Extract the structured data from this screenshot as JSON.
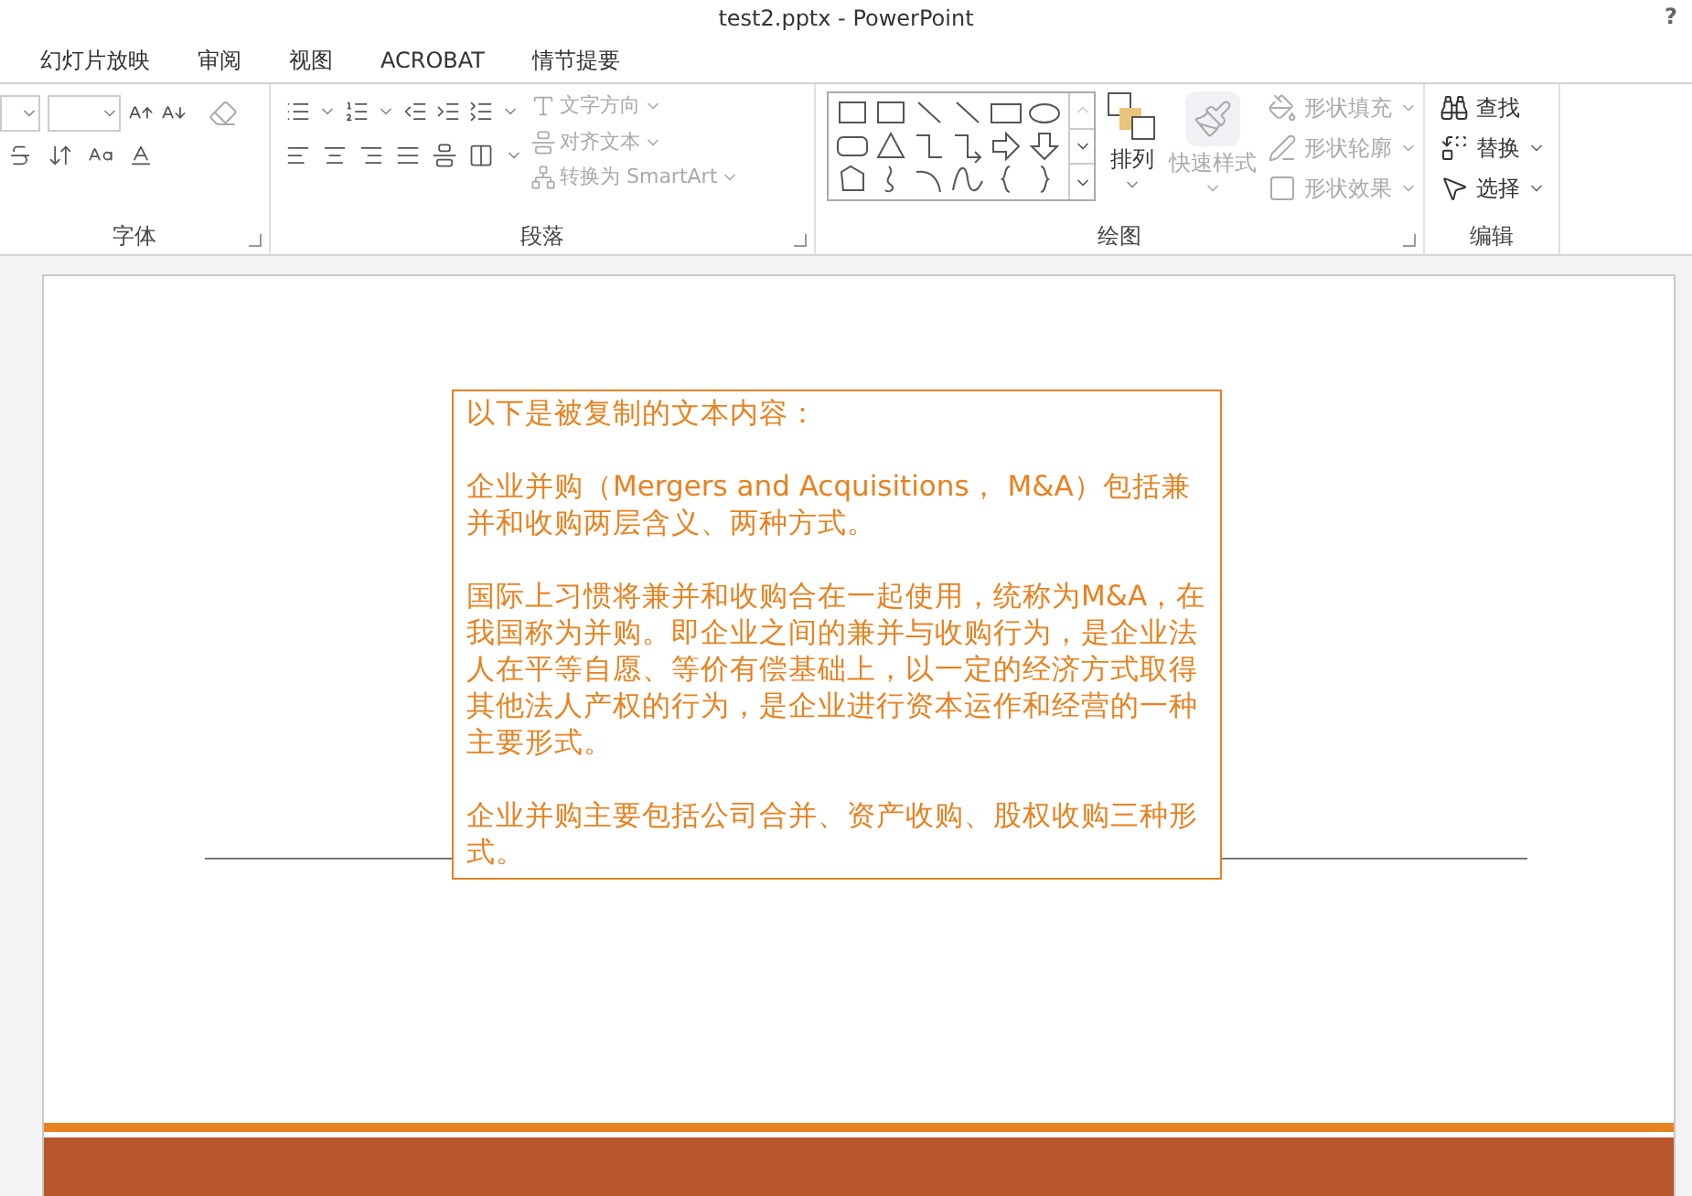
{
  "window": {
    "title": "test2.pptx - PowerPoint",
    "help": "?"
  },
  "tabs": [
    {
      "label": "幻灯片放映",
      "selected": false
    },
    {
      "label": "审阅",
      "selected": false
    },
    {
      "label": "视图",
      "selected": false
    },
    {
      "label": "ACROBAT",
      "selected": false
    },
    {
      "label": "情节提要",
      "selected": false
    }
  ],
  "ribbon": {
    "font_group": {
      "label": "字体"
    },
    "paragraph_group": {
      "label": "段落",
      "commands": [
        {
          "label": "文字方向",
          "disabled": true
        },
        {
          "label": "对齐文本",
          "disabled": true
        },
        {
          "label": "转换为 SmartArt",
          "disabled": true
        }
      ]
    },
    "drawing_group": {
      "label": "绘图",
      "arrange": "排列",
      "quick_styles": {
        "label": "快速样式",
        "disabled": true
      },
      "commands": [
        {
          "label": "形状填充",
          "disabled": true
        },
        {
          "label": "形状轮廓",
          "disabled": true
        },
        {
          "label": "形状效果",
          "disabled": true
        }
      ]
    },
    "editing_group": {
      "label": "编辑",
      "commands": [
        {
          "kind": "find",
          "label": "查找"
        },
        {
          "kind": "replace",
          "label": "替换"
        },
        {
          "kind": "select",
          "label": "选择"
        }
      ]
    }
  },
  "slide": {
    "text_box": {
      "paragraphs": [
        "以下是被复制的文本内容：",
        "企业并购（Mergers and Acquisitions， M&A）包括兼并和收购两层含义、两种方式。",
        "国际上习惯将兼并和收购合在一起使用，统称为M&A，在我国称为并购。即企业之间的兼并与收购行为，是企业法人在平等自愿、等价有偿基础上，以一定的经济方式取得其他法人产权的行为，是企业进行资本运作和经营的一种主要形式。",
        "企业并购主要包括公司合并、资产收购、股权收购三种形式。"
      ]
    }
  }
}
